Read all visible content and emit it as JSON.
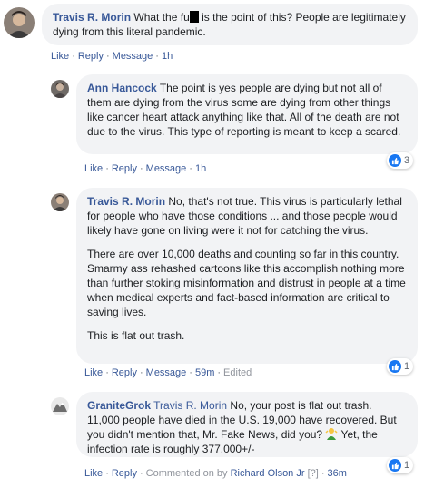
{
  "comments": [
    {
      "author": "Travis R. Morin",
      "text_before": "What the fu",
      "text_after": " is the point of this? People are legitimately dying from this literal pandemic.",
      "actions": [
        "Like",
        "Reply",
        "Message",
        "1h"
      ],
      "reactions": null
    },
    {
      "author": "Ann Hancock",
      "text": "The point is yes people are dying but not all of them are dying from the virus some are dying from other things like cancer heart attack anything like that. All of the death are not due to the virus. This type of reporting is meant to keep a scared.",
      "actions": [
        "Like",
        "Reply",
        "Message",
        "1h"
      ],
      "reactions": "3"
    },
    {
      "author": "Travis R. Morin",
      "paragraphs": [
        "No, that's not true. This virus is particularly lethal for people who have those conditions ... and those people would likely have gone on living were it not for catching the virus.",
        "There are over 10,000 deaths and counting so far in this country. Smarmy ass rehashed cartoons like this accomplish nothing more than further stoking misinformation and distrust in people at a time when medical experts and fact-based information are critical to saving lives.",
        "This is flat out trash."
      ],
      "actions": [
        "Like",
        "Reply",
        "Message",
        "59m",
        "Edited"
      ],
      "reactions": "1"
    },
    {
      "author": "GraniteGrok",
      "mention": "Travis R. Morin",
      "text_before": " No, your post is flat out trash. 11,000 people have died in the U.S. 19,000 have recovered. But you didn't mention that, Mr. Fake News, did you? ",
      "text_after": " Yet, the infection rate is roughly 377,000+/-",
      "actions": [
        "Like",
        "Reply"
      ],
      "commented_on_by": "Commented on by",
      "commenter": "Richard Olson Jr",
      "info_marker": "[?]",
      "time": "36m",
      "reactions": "1"
    }
  ],
  "colors": {
    "link": "#385898",
    "bubble": "#f2f3f5",
    "like_blue": "#1877f2",
    "meta": "#606770"
  },
  "icons": {
    "like": "thumbs-up-icon",
    "emoji": "shrugging-person-emoji"
  }
}
